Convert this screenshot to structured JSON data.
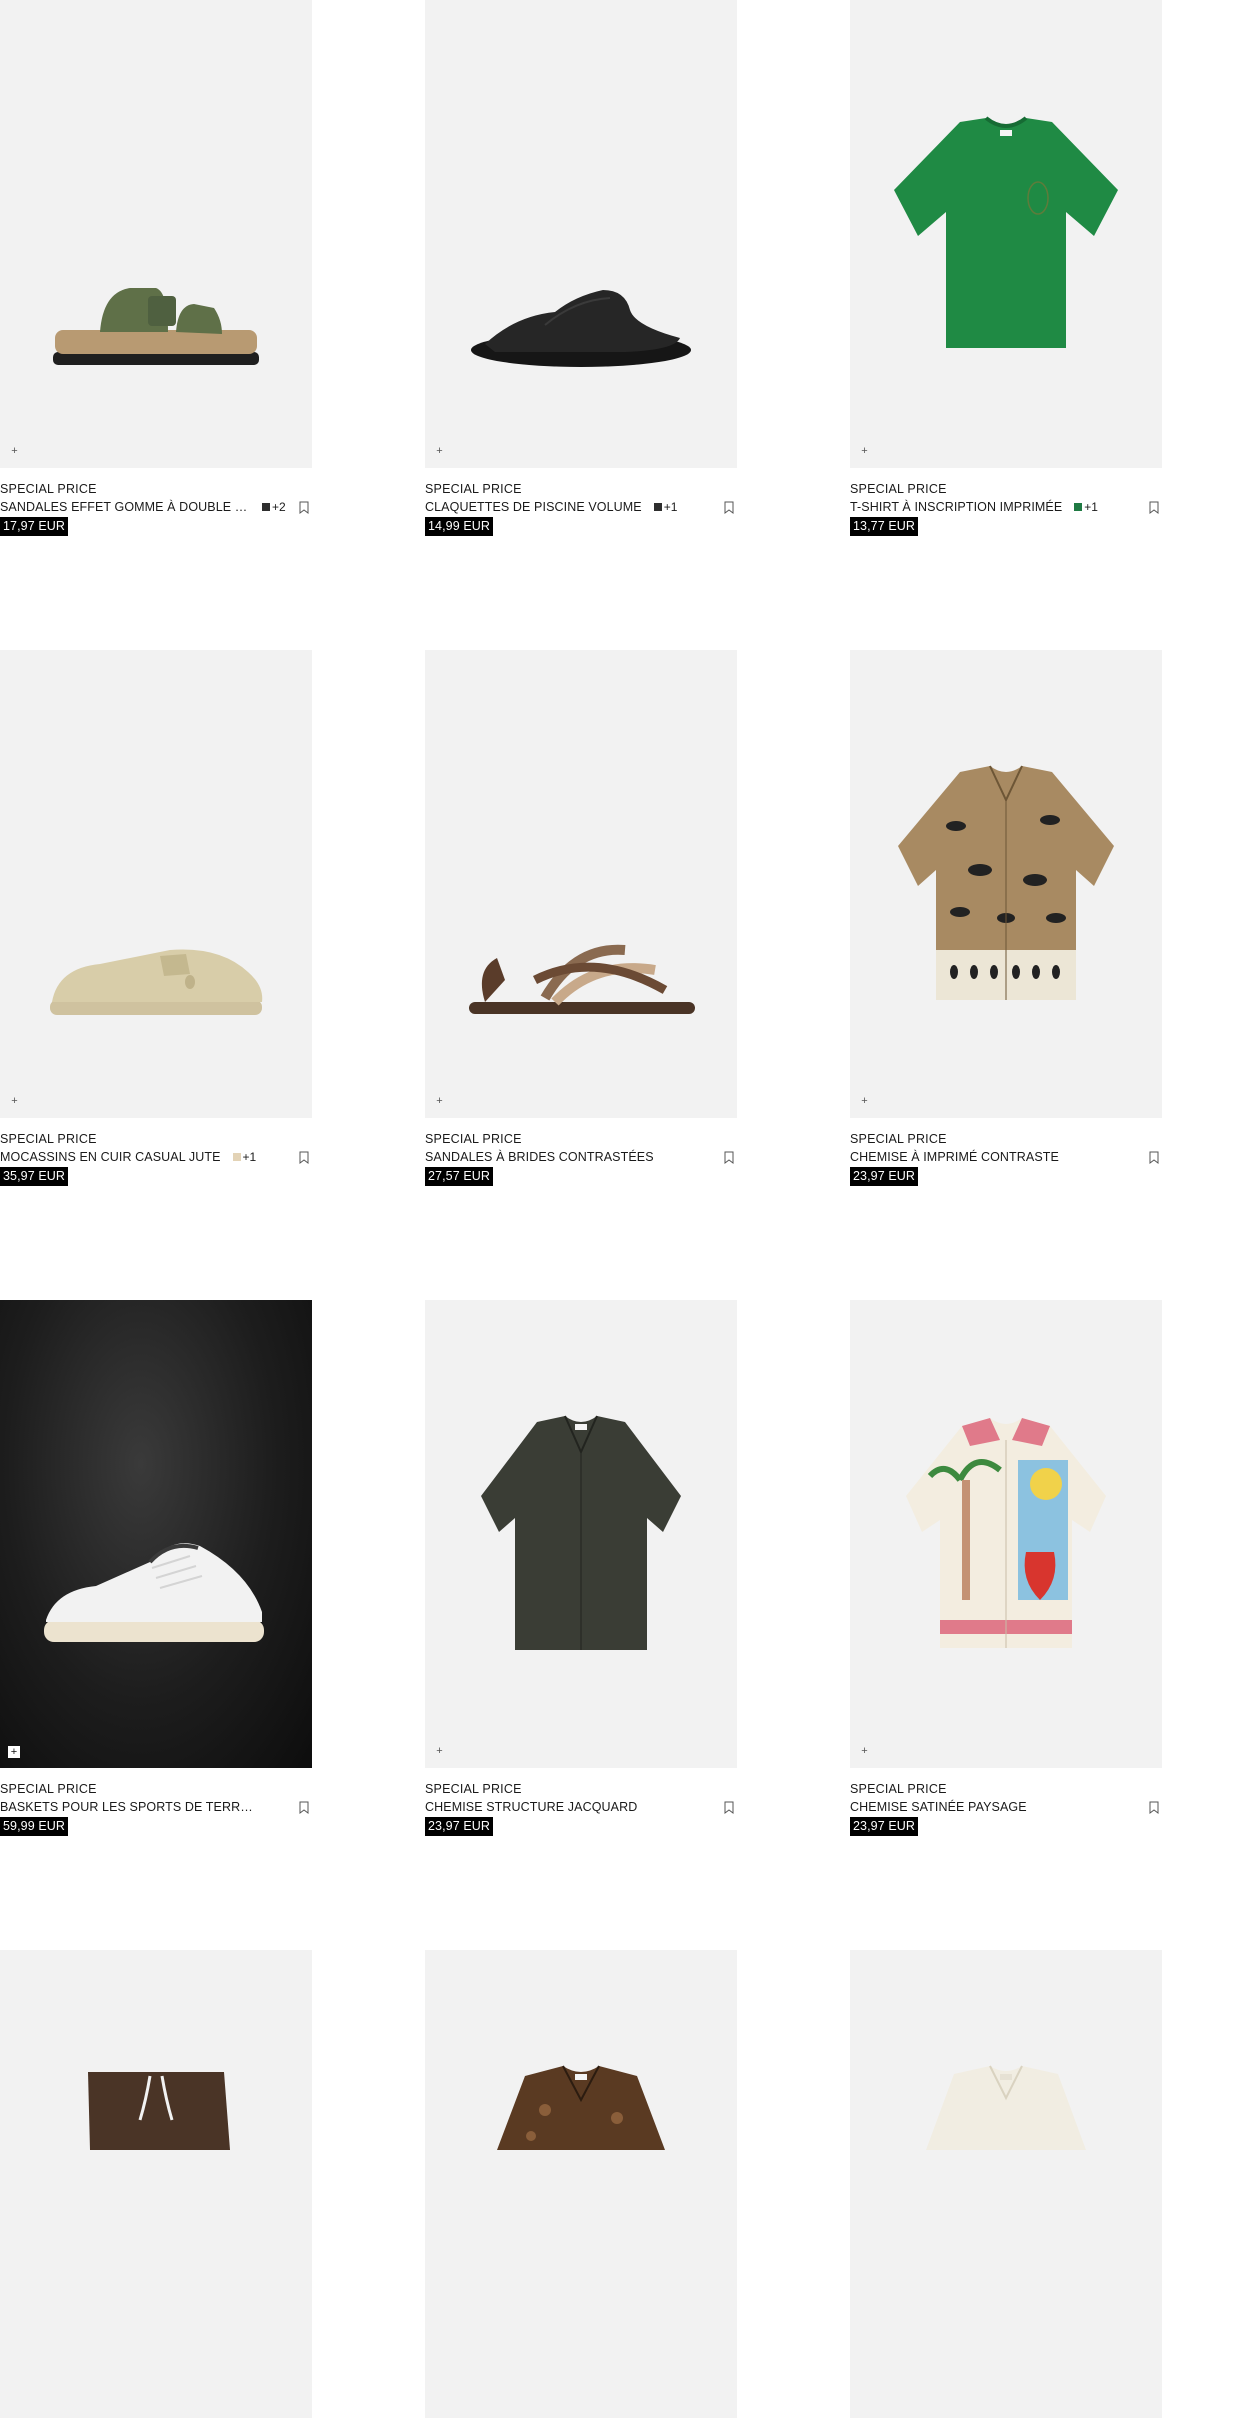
{
  "products": [
    {
      "badge": "SPECIAL PRICE",
      "name": "SANDALES EFFET GOMME À DOUBLE BRIDE",
      "price": "17,97 EUR",
      "extra_colors": "+2",
      "swatch": "#2e2e2e"
    },
    {
      "badge": "SPECIAL PRICE",
      "name": "CLAQUETTES DE PISCINE VOLUME",
      "price": "14,99 EUR",
      "extra_colors": "+1",
      "swatch": "#2e2e2e"
    },
    {
      "badge": "SPECIAL PRICE",
      "name": "T-SHIRT À INSCRIPTION IMPRIMÉE",
      "price": "13,77 EUR",
      "extra_colors": "+1",
      "swatch": "#1f7a43"
    },
    {
      "badge": "SPECIAL PRICE",
      "name": "MOCASSINS EN CUIR CASUAL JUTE",
      "price": "35,97 EUR",
      "extra_colors": "+1",
      "swatch": "#e3d3b6"
    },
    {
      "badge": "SPECIAL PRICE",
      "name": "SANDALES À BRIDES CONTRASTÉES",
      "price": "27,57 EUR"
    },
    {
      "badge": "SPECIAL PRICE",
      "name": "CHEMISE À IMPRIMÉ CONTRASTE",
      "price": "23,97 EUR"
    },
    {
      "badge": "SPECIAL PRICE",
      "name": "BASKETS POUR LES SPORTS DE TERRAIN",
      "price": "59,99 EUR"
    },
    {
      "badge": "SPECIAL PRICE",
      "name": "CHEMISE STRUCTURE JACQUARD",
      "price": "23,97 EUR"
    },
    {
      "badge": "SPECIAL PRICE",
      "name": "CHEMISE SATINÉE PAYSAGE",
      "price": "23,97 EUR"
    }
  ],
  "icons": {
    "quick_add": "plus-icon",
    "bookmark": "bookmark-icon"
  },
  "quick_add_symbol": "+"
}
